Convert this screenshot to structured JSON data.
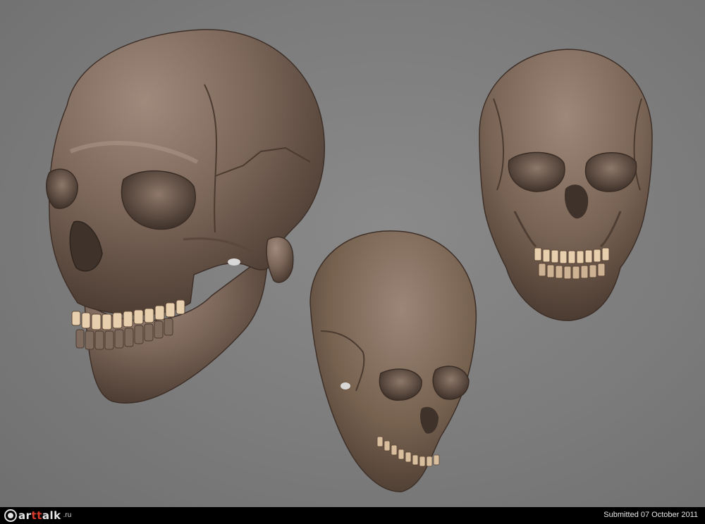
{
  "logo": {
    "text_prefix": "ar",
    "text_accent": "tt",
    "text_rest": "alk",
    "suffix": ".ru"
  },
  "footer": {
    "submitted": "Submitted 07 October 2011"
  },
  "colors": {
    "background": "#7d7d7d",
    "bone": "#7a6558",
    "bone_light": "#a08a7c",
    "bone_dark": "#4e3e34",
    "teeth": "#e8cfae",
    "footer_bar": "#000000",
    "logo_accent": "#d63a2a"
  }
}
